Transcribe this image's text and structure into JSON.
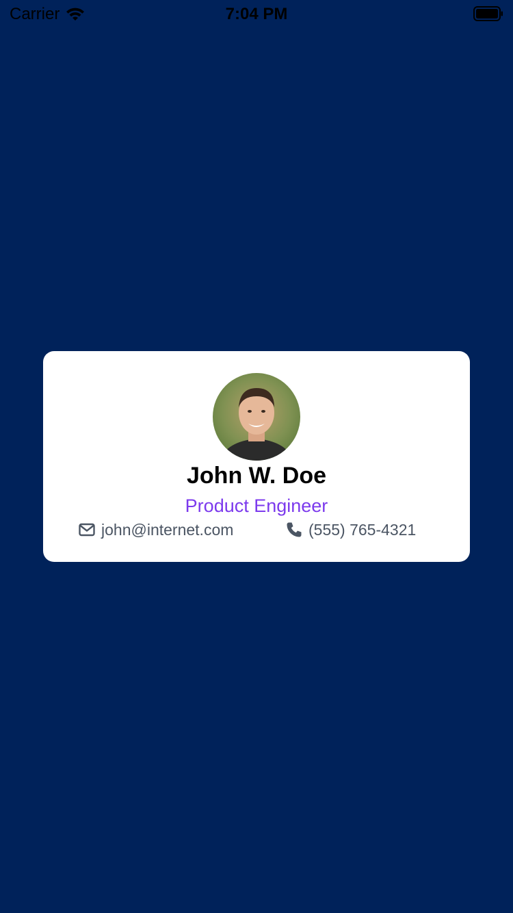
{
  "status_bar": {
    "carrier": "Carrier",
    "time": "7:04 PM",
    "wifi_icon": "wifi-icon",
    "battery_icon": "battery-icon"
  },
  "colors": {
    "background": "#00225a",
    "card": "#ffffff",
    "role_text": "#7c3aed",
    "contact_text": "#4b5563"
  },
  "card": {
    "avatar_icon": "avatar-photo",
    "name": "John W. Doe",
    "role": "Product Engineer",
    "email": {
      "icon": "envelope-icon",
      "value": "john@internet.com"
    },
    "phone": {
      "icon": "phone-icon",
      "value": "(555) 765-4321"
    }
  }
}
